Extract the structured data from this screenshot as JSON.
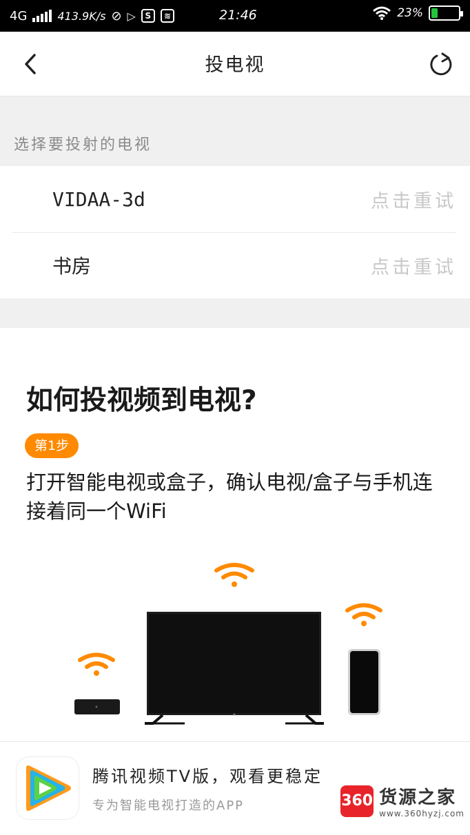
{
  "status_bar": {
    "network": "4G",
    "speed": "413.9K/s",
    "time": "21:46",
    "battery": "23%",
    "battery_level": 0.23
  },
  "header": {
    "title": "投电视"
  },
  "devices": {
    "section_label": "选择要投射的电视",
    "items": [
      {
        "name": "VIDAA-3d",
        "action": "点击重试"
      },
      {
        "name": "书房",
        "action": "点击重试"
      }
    ]
  },
  "guide": {
    "title": "如何投视频到电视?",
    "step_badge": "第1步",
    "step_text": "打开智能电视或盒子，确认电视/盒子与手机连接着同一个WiFi"
  },
  "banner": {
    "title": "腾讯视频TV版，观看更稳定",
    "subtitle": "专为智能电视打造的APP"
  },
  "watermark": {
    "logo": "360",
    "brand": "货源之家",
    "url": "www.360hyzj.com"
  },
  "colors": {
    "accent": "#ff8a00",
    "retry_text": "#c8c8c8",
    "section_bg": "#f0f0f0"
  }
}
